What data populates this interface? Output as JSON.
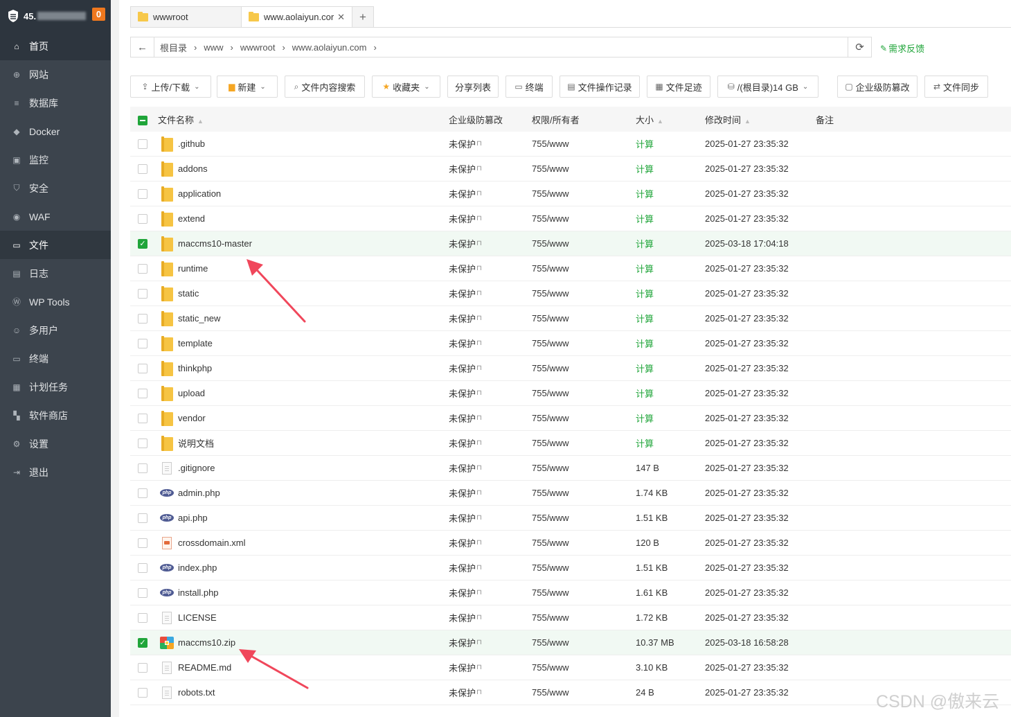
{
  "sidebar": {
    "ip_prefix": "45.",
    "badge": "0",
    "items": [
      {
        "label": "首页",
        "icon": "home-icon",
        "state": "active"
      },
      {
        "label": "网站",
        "icon": "globe-icon",
        "state": ""
      },
      {
        "label": "数据库",
        "icon": "database-icon",
        "state": ""
      },
      {
        "label": "Docker",
        "icon": "docker-icon",
        "state": ""
      },
      {
        "label": "监控",
        "icon": "monitor-icon",
        "state": ""
      },
      {
        "label": "安全",
        "icon": "shield-icon",
        "state": ""
      },
      {
        "label": "WAF",
        "icon": "waf-icon",
        "state": ""
      },
      {
        "label": "文件",
        "icon": "folder-icon",
        "state": "selected"
      },
      {
        "label": "日志",
        "icon": "log-icon",
        "state": ""
      },
      {
        "label": "WP Tools",
        "icon": "wordpress-icon",
        "state": ""
      },
      {
        "label": "多用户",
        "icon": "users-icon",
        "state": ""
      },
      {
        "label": "终端",
        "icon": "terminal-icon",
        "state": ""
      },
      {
        "label": "计划任务",
        "icon": "calendar-icon",
        "state": ""
      },
      {
        "label": "软件商店",
        "icon": "apps-icon",
        "state": ""
      },
      {
        "label": "设置",
        "icon": "gear-icon",
        "state": ""
      },
      {
        "label": "退出",
        "icon": "logout-icon",
        "state": ""
      }
    ]
  },
  "tabs": [
    {
      "label": "wwwroot"
    },
    {
      "label": "www.aolaiyun.cor"
    }
  ],
  "tab_add": "+",
  "breadcrumb": [
    "根目录",
    "www",
    "wwwroot",
    "www.aolaiyun.com"
  ],
  "feedback": "需求反馈",
  "toolbar": {
    "upload": "上传/下载",
    "new": "新建",
    "search": "文件内容搜索",
    "favorites": "收藏夹",
    "share": "分享列表",
    "terminal": "终端",
    "oplog": "文件操作记录",
    "footprint": "文件足迹",
    "disk": "/(根目录)14 GB",
    "tamper": "企业级防篡改",
    "sync": "文件同步"
  },
  "columns": {
    "name": "文件名称",
    "tamper": "企业级防篡改",
    "perm": "权限/所有者",
    "size": "大小",
    "mtime": "修改时间",
    "note": "备注"
  },
  "files": [
    {
      "name": ".github",
      "type": "folder",
      "tamper": "未保护",
      "perm": "755/www",
      "size": "计算",
      "mtime": "2025-01-27 23:35:32",
      "checked": false
    },
    {
      "name": "addons",
      "type": "folder",
      "tamper": "未保护",
      "perm": "755/www",
      "size": "计算",
      "mtime": "2025-01-27 23:35:32",
      "checked": false
    },
    {
      "name": "application",
      "type": "folder",
      "tamper": "未保护",
      "perm": "755/www",
      "size": "计算",
      "mtime": "2025-01-27 23:35:32",
      "checked": false
    },
    {
      "name": "extend",
      "type": "folder",
      "tamper": "未保护",
      "perm": "755/www",
      "size": "计算",
      "mtime": "2025-01-27 23:35:32",
      "checked": false
    },
    {
      "name": "maccms10-master",
      "type": "folder",
      "tamper": "未保护",
      "perm": "755/www",
      "size": "计算",
      "mtime": "2025-03-18 17:04:18",
      "checked": true
    },
    {
      "name": "runtime",
      "type": "folder",
      "tamper": "未保护",
      "perm": "755/www",
      "size": "计算",
      "mtime": "2025-01-27 23:35:32",
      "checked": false
    },
    {
      "name": "static",
      "type": "folder",
      "tamper": "未保护",
      "perm": "755/www",
      "size": "计算",
      "mtime": "2025-01-27 23:35:32",
      "checked": false
    },
    {
      "name": "static_new",
      "type": "folder",
      "tamper": "未保护",
      "perm": "755/www",
      "size": "计算",
      "mtime": "2025-01-27 23:35:32",
      "checked": false
    },
    {
      "name": "template",
      "type": "folder",
      "tamper": "未保护",
      "perm": "755/www",
      "size": "计算",
      "mtime": "2025-01-27 23:35:32",
      "checked": false
    },
    {
      "name": "thinkphp",
      "type": "folder",
      "tamper": "未保护",
      "perm": "755/www",
      "size": "计算",
      "mtime": "2025-01-27 23:35:32",
      "checked": false
    },
    {
      "name": "upload",
      "type": "folder",
      "tamper": "未保护",
      "perm": "755/www",
      "size": "计算",
      "mtime": "2025-01-27 23:35:32",
      "checked": false
    },
    {
      "name": "vendor",
      "type": "folder",
      "tamper": "未保护",
      "perm": "755/www",
      "size": "计算",
      "mtime": "2025-01-27 23:35:32",
      "checked": false
    },
    {
      "name": "说明文档",
      "type": "folder",
      "tamper": "未保护",
      "perm": "755/www",
      "size": "计算",
      "mtime": "2025-01-27 23:35:32",
      "checked": false
    },
    {
      "name": ".gitignore",
      "type": "file",
      "tamper": "未保护",
      "perm": "755/www",
      "size": "147 B",
      "mtime": "2025-01-27 23:35:32",
      "checked": false
    },
    {
      "name": "admin.php",
      "type": "php",
      "tamper": "未保护",
      "perm": "755/www",
      "size": "1.74 KB",
      "mtime": "2025-01-27 23:35:32",
      "checked": false
    },
    {
      "name": "api.php",
      "type": "php",
      "tamper": "未保护",
      "perm": "755/www",
      "size": "1.51 KB",
      "mtime": "2025-01-27 23:35:32",
      "checked": false
    },
    {
      "name": "crossdomain.xml",
      "type": "xml",
      "tamper": "未保护",
      "perm": "755/www",
      "size": "120 B",
      "mtime": "2025-01-27 23:35:32",
      "checked": false
    },
    {
      "name": "index.php",
      "type": "php",
      "tamper": "未保护",
      "perm": "755/www",
      "size": "1.51 KB",
      "mtime": "2025-01-27 23:35:32",
      "checked": false
    },
    {
      "name": "install.php",
      "type": "php",
      "tamper": "未保护",
      "perm": "755/www",
      "size": "1.61 KB",
      "mtime": "2025-01-27 23:35:32",
      "checked": false
    },
    {
      "name": "LICENSE",
      "type": "file",
      "tamper": "未保护",
      "perm": "755/www",
      "size": "1.72 KB",
      "mtime": "2025-01-27 23:35:32",
      "checked": false
    },
    {
      "name": "maccms10.zip",
      "type": "zip",
      "tamper": "未保护",
      "perm": "755/www",
      "size": "10.37 MB",
      "mtime": "2025-03-18 16:58:28",
      "checked": true
    },
    {
      "name": "README.md",
      "type": "file",
      "tamper": "未保护",
      "perm": "755/www",
      "size": "3.10 KB",
      "mtime": "2025-01-27 23:35:32",
      "checked": false
    },
    {
      "name": "robots.txt",
      "type": "file",
      "tamper": "未保护",
      "perm": "755/www",
      "size": "24 B",
      "mtime": "2025-01-27 23:35:32",
      "checked": false
    }
  ],
  "colors": {
    "accent": "#20a53a",
    "sidebar": "#3c444d",
    "annotation": "#f0475b"
  },
  "watermark": "CSDN @傲来云"
}
